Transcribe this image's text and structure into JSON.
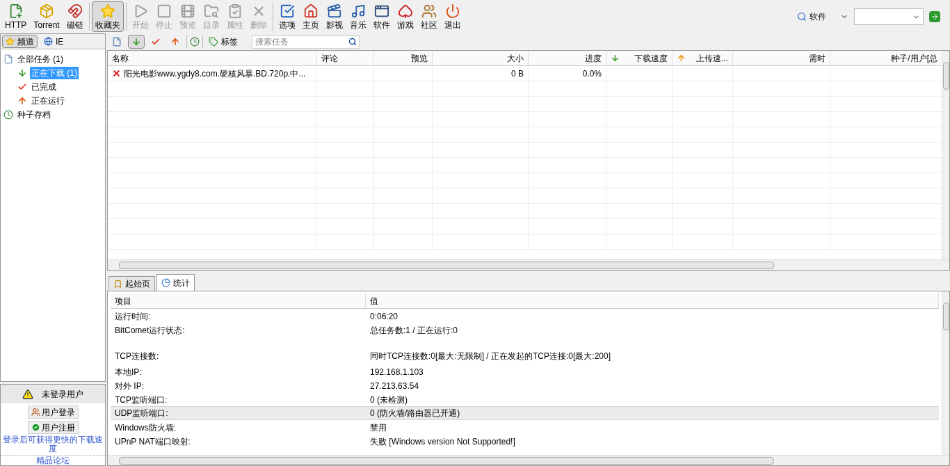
{
  "toolbar": {
    "groups": [
      [
        {
          "label": "HTTP",
          "disabled": false,
          "selected": false
        },
        {
          "label": "Torrent",
          "disabled": false,
          "selected": false
        },
        {
          "label": "磁链",
          "disabled": false,
          "selected": false
        }
      ],
      [
        {
          "label": "收藏夹",
          "disabled": false,
          "selected": true
        }
      ],
      [
        {
          "label": "开始",
          "disabled": true,
          "selected": false
        },
        {
          "label": "停止",
          "disabled": true,
          "selected": false
        },
        {
          "label": "预览",
          "disabled": true,
          "selected": false
        },
        {
          "label": "目录",
          "disabled": true,
          "selected": false
        },
        {
          "label": "属性",
          "disabled": true,
          "selected": false
        },
        {
          "label": "删除",
          "disabled": true,
          "selected": false
        }
      ],
      [
        {
          "label": "选项",
          "disabled": false,
          "selected": false
        },
        {
          "label": "主页",
          "disabled": false,
          "selected": false
        },
        {
          "label": "影视",
          "disabled": false,
          "selected": false
        },
        {
          "label": "音乐",
          "disabled": false,
          "selected": false
        },
        {
          "label": "软件",
          "disabled": false,
          "selected": false
        },
        {
          "label": "游戏",
          "disabled": false,
          "selected": false
        },
        {
          "label": "社区",
          "disabled": false,
          "selected": false
        },
        {
          "label": "退出",
          "disabled": false,
          "selected": false
        }
      ]
    ],
    "search": {
      "engine": "软件"
    }
  },
  "sidebar": {
    "tabs": [
      {
        "label": "频道",
        "selected": true
      },
      {
        "label": "IE",
        "selected": false
      }
    ],
    "tree": [
      {
        "label": "全部任务 (1)",
        "selected": false,
        "children": [
          {
            "label": "正在下载 (1)",
            "selected": true
          },
          {
            "label": "已完成",
            "selected": false
          },
          {
            "label": "正在运行",
            "selected": false
          }
        ]
      },
      {
        "label": "种子存档",
        "selected": false
      }
    ],
    "user": {
      "status": "未登录用户",
      "buttons": [
        "用户登录",
        "用户注册"
      ],
      "links": [
        "登录后可获得更快的下载速度",
        "精品论坛"
      ]
    }
  },
  "task_toolbar": {
    "filters": [
      {
        "selected": false
      },
      {
        "selected": true
      },
      {
        "selected": false
      },
      {
        "selected": false
      }
    ],
    "tag_button": "标签",
    "search": {
      "placeholder": "搜索任务"
    }
  },
  "table": {
    "columns": [
      "名称",
      "评论",
      "预览",
      "大小",
      "进度",
      "下载速度",
      "上传速...",
      "需时",
      "种子/用户[总"
    ],
    "rows": [
      {
        "failed": true,
        "cells": [
          "阳光电影www.ygdy8.com.硬核风暴.BD.720p.中...",
          "",
          "",
          "0 B",
          "0.0%",
          "",
          "",
          "",
          ""
        ]
      }
    ]
  },
  "bottom_tabs": [
    {
      "label": "起始页",
      "selected": false
    },
    {
      "label": "统计",
      "selected": true
    }
  ],
  "stats": {
    "columns": [
      "项目",
      "值"
    ],
    "rows": [
      {
        "item": "运行时间:",
        "value": "0:06:20",
        "selected": false,
        "gap_before": false
      },
      {
        "item": "BitComet运行状态:",
        "value": "总任务数:1 / 正在运行:0",
        "selected": false,
        "gap_before": false
      },
      {
        "item": "TCP连接数:",
        "value": "同时TCP连接数:0[最大:无限制] / 正在发起的TCP连接:0[最大:200]",
        "selected": false,
        "gap_before": true
      },
      {
        "item": "本地IP:",
        "value": "192.168.1.103",
        "selected": false,
        "gap_before": false
      },
      {
        "item": "对外 IP:",
        "value": "27.213.63.54",
        "selected": false,
        "gap_before": false
      },
      {
        "item": "TCP监听端口:",
        "value": "0 (未检测)",
        "selected": false,
        "gap_before": false
      },
      {
        "item": "UDP监听端口:",
        "value": "0 (防火墙/路由器已开通)",
        "selected": true,
        "gap_before": false
      },
      {
        "item": "Windows防火墙:",
        "value": "禁用",
        "selected": false,
        "gap_before": false
      },
      {
        "item": "UPnP NAT端口映射:",
        "value": "失败 [Windows version Not Supported!]",
        "selected": false,
        "gap_before": false
      }
    ]
  }
}
